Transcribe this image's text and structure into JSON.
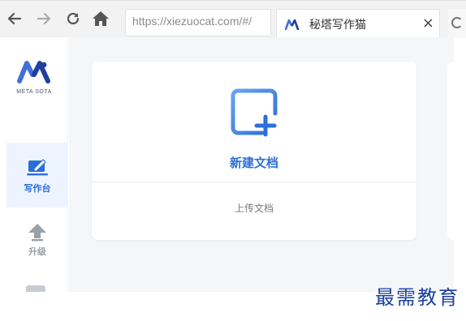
{
  "browser": {
    "url": "https://xiezuocat.com/#/",
    "tab_title": "秘塔写作猫",
    "tab_close": "×",
    "icons": [
      "back-icon",
      "forward-icon",
      "reload-icon",
      "home-icon",
      "close-icon"
    ]
  },
  "sidebar": {
    "brand_text": "META SOTA",
    "items": [
      {
        "label": "写作台",
        "icon": "notebook-pen-icon",
        "active": true
      },
      {
        "label": "升级",
        "icon": "upload-arrow-icon",
        "active": false
      }
    ]
  },
  "main": {
    "card": {
      "title": "新建文档",
      "action": "上传文档",
      "icon": "new-document-icon"
    }
  },
  "watermark": "最需教育",
  "colors": {
    "accent": "#2b6fd8",
    "muted": "#9aa0a8",
    "background": "#f5f6f8"
  }
}
